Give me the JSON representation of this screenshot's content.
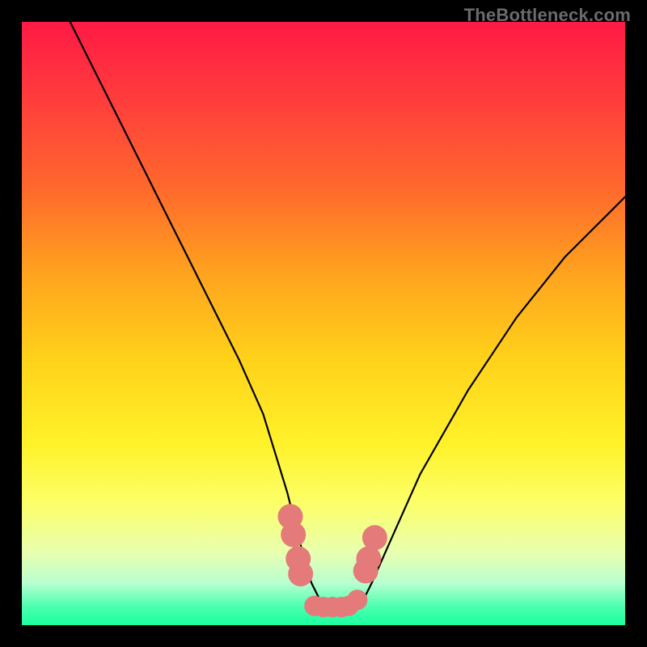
{
  "watermark": "TheBottleneck.com",
  "chart_data": {
    "type": "line",
    "title": "",
    "xlabel": "",
    "ylabel": "",
    "xlim": [
      0,
      100
    ],
    "ylim": [
      0,
      100
    ],
    "grid": false,
    "legend": false,
    "series": [
      {
        "name": "curve",
        "x": [
          8,
          12,
          16,
          20,
          24,
          28,
          32,
          36,
          40,
          44,
          46,
          48,
          50,
          52,
          54,
          56,
          58,
          62,
          66,
          70,
          74,
          78,
          82,
          86,
          90,
          94,
          98,
          100
        ],
        "y": [
          100,
          92,
          84,
          76,
          68,
          60,
          52,
          44,
          35,
          22,
          14,
          7,
          3,
          2,
          2,
          3,
          7,
          16,
          25,
          32,
          39,
          45,
          51,
          56,
          61,
          65,
          69,
          71
        ]
      }
    ],
    "markers": {
      "name": "highlighted-points",
      "color": "#e47a7a",
      "points": [
        {
          "x": 44.5,
          "y": 18,
          "r": 1.6
        },
        {
          "x": 45.0,
          "y": 15,
          "r": 1.6
        },
        {
          "x": 45.8,
          "y": 11,
          "r": 1.6
        },
        {
          "x": 46.2,
          "y": 8.5,
          "r": 1.6
        },
        {
          "x": 48.5,
          "y": 3.2,
          "r": 1.3
        },
        {
          "x": 50.0,
          "y": 3.0,
          "r": 1.3
        },
        {
          "x": 51.5,
          "y": 3.0,
          "r": 1.3
        },
        {
          "x": 53.0,
          "y": 3.0,
          "r": 1.3
        },
        {
          "x": 54.2,
          "y": 3.2,
          "r": 1.3
        },
        {
          "x": 55.6,
          "y": 4.2,
          "r": 1.3
        },
        {
          "x": 57.0,
          "y": 9.0,
          "r": 1.6
        },
        {
          "x": 57.5,
          "y": 11.0,
          "r": 1.6
        },
        {
          "x": 58.5,
          "y": 14.5,
          "r": 1.6
        }
      ]
    },
    "background_gradient": {
      "top_color": "#ff1a45",
      "bottom_color": "#1aff9e"
    }
  }
}
